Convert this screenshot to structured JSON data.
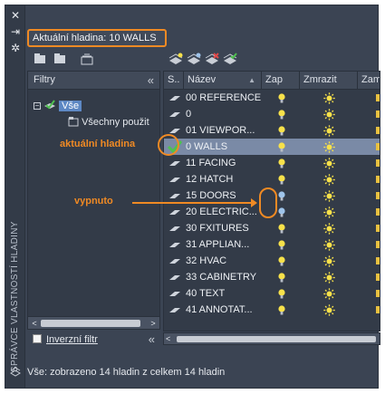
{
  "window": {
    "title_vertical": "SPRÁVCE VLASTNOSTÍ HLADINY",
    "close_glyph": "✕",
    "autohide_glyph": "⇥",
    "settings_glyph": "✲"
  },
  "current_layer": {
    "label": "Aktuální hladina: 10 WALLS"
  },
  "filters": {
    "header": "Filtry",
    "collapse_glyph": "«",
    "tree": [
      {
        "label": "Vše",
        "selected": true
      },
      {
        "label": "Všechny použit"
      }
    ],
    "scroll_left": "<",
    "scroll_right": ">",
    "inverse_filter_label": "Inverzní filtr",
    "inverse_checked": false
  },
  "columns": {
    "status": "S..",
    "name": "Název",
    "sort_glyph": "▲",
    "on": "Zap",
    "freeze": "Zmrazit",
    "lock": "Zam"
  },
  "layers": [
    {
      "name": "00 REFERENCE",
      "on": true,
      "current": false
    },
    {
      "name": "0",
      "on": true,
      "current": false
    },
    {
      "name": "01 VIEWPOR...",
      "on": true,
      "current": false
    },
    {
      "name": "0 WALLS",
      "on": true,
      "current": true
    },
    {
      "name": "11 FACING",
      "on": true,
      "current": false
    },
    {
      "name": "12 HATCH",
      "on": true,
      "current": false
    },
    {
      "name": "15 DOORS",
      "on": false,
      "current": false
    },
    {
      "name": "20 ELECTRIC...",
      "on": false,
      "current": false
    },
    {
      "name": "30 FXITURES",
      "on": true,
      "current": false
    },
    {
      "name": "31 APPLIAN...",
      "on": true,
      "current": false
    },
    {
      "name": "32 HVAC",
      "on": true,
      "current": false
    },
    {
      "name": "33 CABINETRY",
      "on": true,
      "current": false
    },
    {
      "name": "40 TEXT",
      "on": true,
      "current": false
    },
    {
      "name": "41 ANNOTAT...",
      "on": true,
      "current": false
    }
  ],
  "grid_scroll_left": "<",
  "status_bar": "Vše: zobrazeno 14 hladin z celkem 14 hladin",
  "annotations": {
    "current_layer": "aktuální hladina",
    "turned_off": "vypnuto"
  },
  "colors": {
    "accent_annotation": "#f08a24",
    "selection": "#5d88c4",
    "current_row": "#7a8aa6",
    "bulb_on": "#f7e14a",
    "bulb_off": "#9fc4ea"
  }
}
